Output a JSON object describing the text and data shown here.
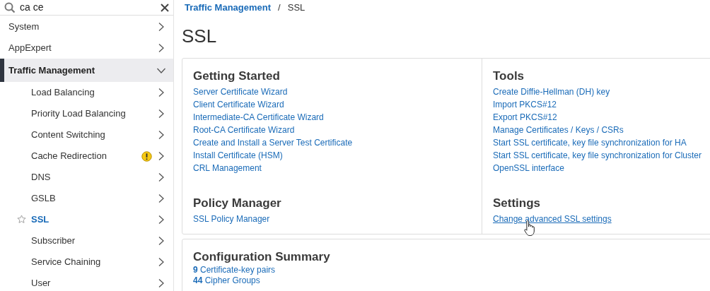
{
  "search": {
    "value": "ca ce"
  },
  "nav": [
    {
      "label": "System",
      "expanded": false,
      "selected": false
    },
    {
      "label": "AppExpert",
      "expanded": false,
      "selected": false
    },
    {
      "label": "Traffic Management",
      "expanded": true,
      "selected": false,
      "children": [
        {
          "label": "Load Balancing",
          "selected": false,
          "warning": false
        },
        {
          "label": "Priority Load Balancing",
          "selected": false,
          "warning": false
        },
        {
          "label": "Content Switching",
          "selected": false,
          "warning": false
        },
        {
          "label": "Cache Redirection",
          "selected": false,
          "warning": true
        },
        {
          "label": "DNS",
          "selected": false,
          "warning": false
        },
        {
          "label": "GSLB",
          "selected": false,
          "warning": false
        },
        {
          "label": "SSL",
          "selected": true,
          "warning": false
        },
        {
          "label": "Subscriber",
          "selected": false,
          "warning": false
        },
        {
          "label": "Service Chaining",
          "selected": false,
          "warning": false
        },
        {
          "label": "User",
          "selected": false,
          "warning": false
        }
      ]
    }
  ],
  "breadcrumb": [
    {
      "label": "Traffic Management",
      "kind": "link"
    },
    {
      "label": "/",
      "kind": "separator"
    },
    {
      "label": "SSL",
      "kind": "current"
    }
  ],
  "page_title": "SSL",
  "panels": [
    {
      "title": "Getting Started",
      "links": [
        {
          "label": "Server Certificate Wizard",
          "hovered": false
        },
        {
          "label": "Client Certificate Wizard",
          "hovered": false
        },
        {
          "label": "Intermediate-CA Certificate Wizard",
          "hovered": false
        },
        {
          "label": "Root-CA Certificate Wizard",
          "hovered": false
        },
        {
          "label": "Create and Install a Server Test Certificate",
          "hovered": false
        },
        {
          "label": "Install Certificate (HSM)",
          "hovered": false
        },
        {
          "label": "CRL Management",
          "hovered": false
        }
      ]
    },
    {
      "title": "Tools",
      "links": [
        {
          "label": "Create Diffie-Hellman (DH) key",
          "hovered": false
        },
        {
          "label": "Import PKCS#12",
          "hovered": false
        },
        {
          "label": "Export PKCS#12",
          "hovered": false
        },
        {
          "label": "Manage Certificates / Keys / CSRs",
          "hovered": false
        },
        {
          "label": "Start SSL certificate, key file synchronization for HA",
          "hovered": false
        },
        {
          "label": "Start SSL certificate, key file synchronization for Cluster",
          "hovered": false
        },
        {
          "label": "OpenSSL interface",
          "hovered": false
        }
      ]
    },
    {
      "title": "Policy Manager",
      "links": [
        {
          "label": "SSL Policy Manager",
          "hovered": false
        }
      ]
    },
    {
      "title": "Settings",
      "links": [
        {
          "label": "Change advanced SSL settings",
          "hovered": true
        }
      ]
    }
  ],
  "configuration_summary": {
    "title": "Configuration Summary",
    "items": [
      "**9** Certificate-key pairs",
      "**44** Cipher Groups"
    ]
  }
}
